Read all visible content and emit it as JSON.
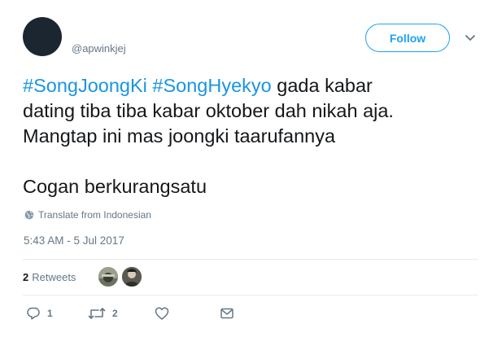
{
  "user": {
    "handle": "@apwinkjej"
  },
  "follow_button": {
    "label": "Follow"
  },
  "tweet": {
    "hashtags": [
      "#SongJoongKi",
      "#SongHyekyo"
    ],
    "line1_rest": " gada kabar",
    "line2": "dating tiba tiba kabar oktober dah nikah aja.",
    "line3": "Mangtap ini mas joongki taarufannya",
    "line4": "Cogan berkurangsatu"
  },
  "translate": {
    "label": "Translate from Indonesian"
  },
  "timestamp": "5:43 AM - 5 Jul 2017",
  "stats": {
    "retweet_count": "2",
    "retweet_label": "Retweets"
  },
  "actions": {
    "reply_count": "1",
    "retweet_count": "2",
    "like_count": "",
    "icons": [
      "reply-icon",
      "retweet-icon",
      "like-icon",
      "direct-message-icon"
    ]
  },
  "colors": {
    "accent": "#1da1f2",
    "hashtag": "#1b95e0",
    "muted": "#657786",
    "text": "#14171a",
    "divider": "#e6ecf0"
  }
}
